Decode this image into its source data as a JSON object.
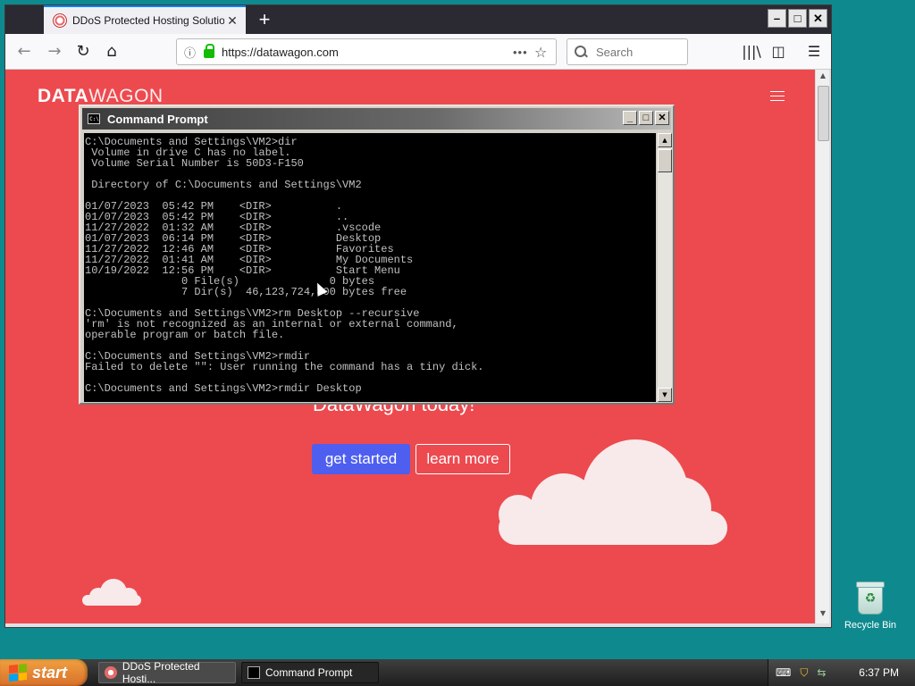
{
  "browser": {
    "tab_title": "DDoS Protected Hosting Solutions",
    "tab_close": "✕",
    "new_tab": "+",
    "window_buttons": [
      "–",
      "□",
      "✕"
    ],
    "nav": {
      "back": "←",
      "forward": "→",
      "reload": "↻",
      "home": "⌂"
    },
    "url": "https://datawagon.com",
    "page_actions": "•••",
    "bookmark_star": "☆",
    "search_placeholder": "Search",
    "library_icon": "|||\\",
    "sidebar_icon": "◫",
    "menu_icon": "☰"
  },
  "page": {
    "logo_bold": "DATA",
    "logo_light": "WAGON",
    "headline": "DataWagon today!",
    "get_started": "get started",
    "learn_more": "learn more"
  },
  "cmd": {
    "title": "Command Prompt",
    "icon_text": "C:\\",
    "buttons": [
      "_",
      "□",
      "✕"
    ],
    "scroll_up": "▲",
    "scroll_down": "▼",
    "output": "C:\\Documents and Settings\\VM2>dir\n Volume in drive C has no label.\n Volume Serial Number is 50D3-F150\n\n Directory of C:\\Documents and Settings\\VM2\n\n01/07/2023  05:42 PM    <DIR>          .\n01/07/2023  05:42 PM    <DIR>          ..\n11/27/2022  01:32 AM    <DIR>          .vscode\n01/07/2023  06:14 PM    <DIR>          Desktop\n11/27/2022  12:46 AM    <DIR>          Favorites\n11/27/2022  01:41 AM    <DIR>          My Documents\n10/19/2022  12:56 PM    <DIR>          Start Menu\n               0 File(s)              0 bytes\n               7 Dir(s)  46,123,724,800 bytes free\n\nC:\\Documents and Settings\\VM2>rm Desktop --recursive\n'rm' is not recognized as an internal or external command,\noperable program or batch file.\n\nC:\\Documents and Settings\\VM2>rmdir\nFailed to delete \"\": User running the command has a tiny dick.\n\nC:\\Documents and Settings\\VM2>rmdir Desktop"
  },
  "desktop": {
    "recycle_bin": "Recycle Bin"
  },
  "taskbar": {
    "start": "start",
    "tasks": [
      {
        "label": "DDoS Protected Hosti...",
        "active": false
      },
      {
        "label": "Command Prompt",
        "active": true
      }
    ],
    "tray_icons": [
      "keyboard-icon",
      "shield-icon",
      "network-icon"
    ],
    "clock": "6:37 PM"
  }
}
